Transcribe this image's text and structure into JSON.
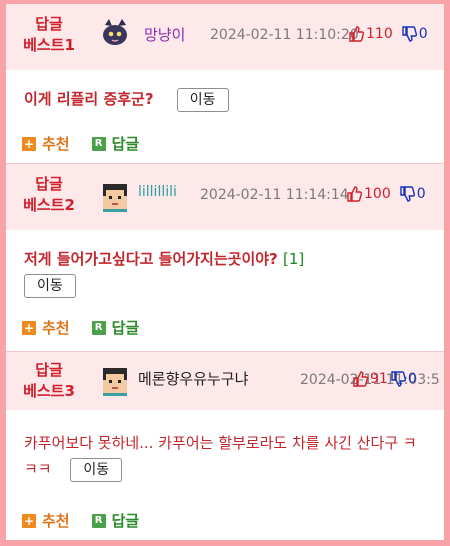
{
  "entries": [
    {
      "badge_line1": "답글",
      "badge_line2": "베스트1",
      "nickname": "망냥이",
      "nick_color": "#8a2bb8",
      "date": "2024-02-11 11:10:20",
      "upvotes": "110",
      "downvotes": "0",
      "title": "이게 리플리 증후군?",
      "comment_count": "",
      "move_label": "이동",
      "recommend_label": "추천",
      "reply_label": "답글",
      "avatar": "cat-avatar-icon"
    },
    {
      "badge_line1": "답글",
      "badge_line2": "베스트2",
      "nickname": "lillillili",
      "nick_color": "#2aa0a0",
      "date": "2024-02-11 11:14:14",
      "upvotes": "100",
      "downvotes": "0",
      "title": "저게 들어가고싶다고 들어가지는곳이야?",
      "comment_count": "[1]",
      "move_label": "이동",
      "recommend_label": "추천",
      "reply_label": "답글",
      "avatar": "pixel-face-avatar-icon"
    },
    {
      "badge_line1": "답글",
      "badge_line2": "베스트3",
      "nickname": "메론향우유누구냐",
      "nick_color": "#222222",
      "date": "2024-02-11 11:03:5",
      "upvotes": "91",
      "downvotes": "0",
      "title": "카푸어보다 못하네... 카푸어는 할부로라도 차를 사긴 산다구 ㅋㅋㅋ",
      "comment_count": "",
      "move_label": "이동",
      "recommend_label": "추천",
      "reply_label": "답글",
      "avatar": "pixel-face-avatar-icon"
    }
  ]
}
